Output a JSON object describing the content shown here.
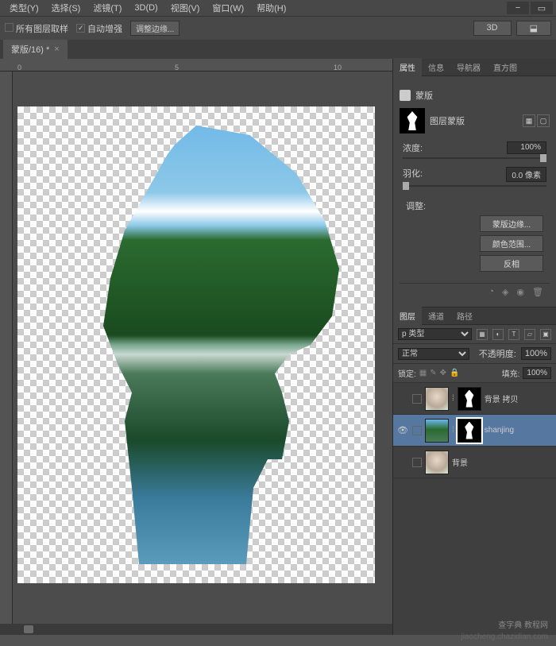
{
  "menu": {
    "type": "类型(Y)",
    "select": "选择(S)",
    "filter": "滤镜(T)",
    "threed": "3D(D)",
    "view": "视图(V)",
    "window": "窗口(W)",
    "help": "帮助(H)"
  },
  "options": {
    "sample_all": "所有图层取样",
    "auto_enhance": "自动增强",
    "refine_edge": "调整边缘...",
    "threed": "3D"
  },
  "tab": {
    "title": "蒙版/16) *",
    "close": "×"
  },
  "ruler": {
    "t0": "0",
    "t1": "5",
    "t2": "10"
  },
  "panels": {
    "properties_tabs": {
      "properties": "属性",
      "info": "信息",
      "navigator": "导航器",
      "histogram": "直方图"
    },
    "mask_title": "蒙版",
    "layer_mask": "图层蒙版",
    "density_label": "浓度:",
    "density_value": "100%",
    "feather_label": "羽化:",
    "feather_value": "0.0 像素",
    "adjust_label": "调整:",
    "btn_maskedge": "蒙版边缘...",
    "btn_colorrange": "颜色范围...",
    "btn_invert": "反相",
    "layers_tabs": {
      "layers": "图层",
      "channels": "通道",
      "paths": "路径"
    },
    "kind": "p 类型",
    "blend": "正常",
    "opacity_label": "不透明度:",
    "opacity_value": "100%",
    "lock_label": "锁定:",
    "fill_label": "填充:",
    "fill_value": "100%",
    "layer1": "背景 拷贝",
    "layer2": "shanjing",
    "layer3": "背景"
  },
  "watermark": {
    "w1": "查字典 教程网",
    "w2": "jiaocheng.chazidian.com"
  }
}
